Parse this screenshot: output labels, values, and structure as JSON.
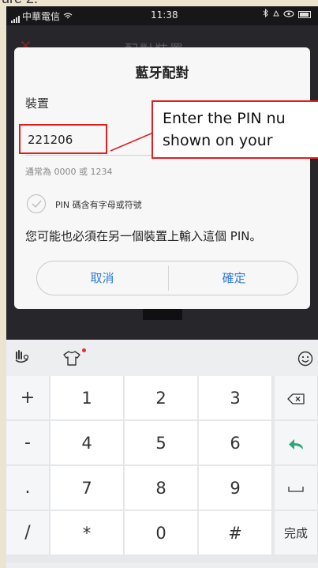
{
  "top_fragment": "ure 2.",
  "status_bar": {
    "carrier": "中華電信",
    "time": "11:38",
    "right_icons": [
      "bluetooth-icon",
      "alarm-icon",
      "eye-icon",
      "battery-icon"
    ]
  },
  "background_app": {
    "title": "配對裝置"
  },
  "dialog": {
    "title": "藍牙配對",
    "device_label": "裝置",
    "pin_value": "221206",
    "pin_hint": "通常為 0000 或 1234",
    "checkbox_label": "PIN 碼含有字母或符號",
    "note": "您可能也必須在另一個裝置上輸入這個 PIN。",
    "cancel_label": "取消",
    "confirm_label": "確定"
  },
  "callout": {
    "line1": "Enter the PIN nu",
    "line2": "shown on your"
  },
  "keyboard": {
    "toolbar_icons": [
      "keyboard-logo-icon",
      "tshirt-skin-icon",
      "emoji-icon"
    ],
    "rows": [
      [
        "+",
        "1",
        "2",
        "3",
        "backspace-icon"
      ],
      [
        "-",
        "4",
        "5",
        "6",
        "enter-arrow-icon"
      ],
      [
        ".",
        "7",
        "8",
        "9",
        "space-icon"
      ],
      [
        "/",
        "*",
        "0",
        "#",
        "完成"
      ]
    ],
    "done_label": "完成",
    "accent_color": "#2aa87a"
  },
  "colors": {
    "highlight_red": "#e02020",
    "button_blue": "#2f7bd9"
  }
}
